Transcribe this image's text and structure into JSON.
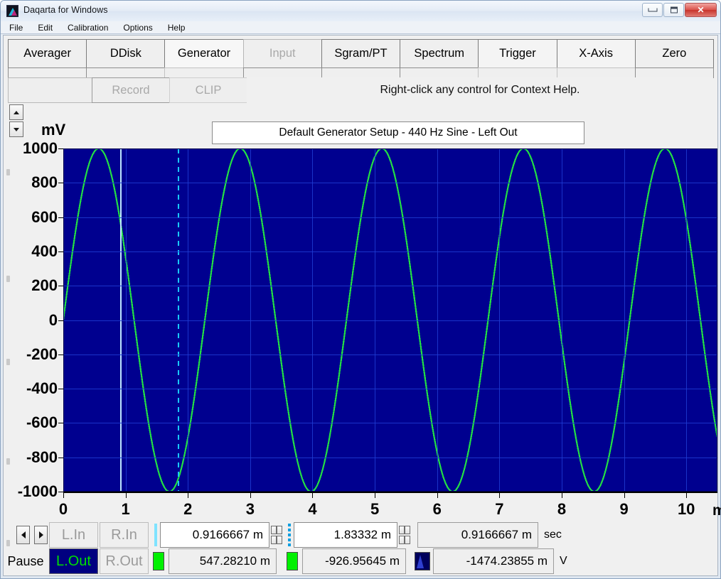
{
  "window": {
    "title": "Daqarta for Windows",
    "icon": "app-logo-icon",
    "minimize_label": "",
    "maximize_label": "",
    "close_label": "✕"
  },
  "menu": {
    "items": [
      "File",
      "Edit",
      "Calibration",
      "Options",
      "Help"
    ]
  },
  "toolbar": {
    "tabs": [
      {
        "label": "Averager",
        "state": "normal"
      },
      {
        "label": "DDisk",
        "state": "normal"
      },
      {
        "label": "Generator",
        "state": "selected"
      },
      {
        "label": "Input",
        "state": "disabled"
      },
      {
        "label": "Sgram/PT",
        "state": "normal"
      },
      {
        "label": "Spectrum",
        "state": "normal"
      },
      {
        "label": "Trigger",
        "state": "hatched"
      },
      {
        "label": "X-Axis",
        "state": "hatched"
      },
      {
        "label": "Zero",
        "state": "normal"
      }
    ],
    "record_label": "Record",
    "clip_label": "CLIP",
    "hint": "Right-click any control for Context Help."
  },
  "chart_data": {
    "type": "line",
    "title": "Default Generator Setup - 440 Hz Sine - Left Out",
    "ylabel": "mV",
    "xlabel": "m",
    "xunit": "m",
    "ylim": [
      -1000,
      1000
    ],
    "xlim": [
      0,
      10.5
    ],
    "yticks": [
      1000,
      800,
      600,
      400,
      200,
      0,
      -200,
      -400,
      -600,
      -800,
      -1000
    ],
    "xticks": [
      0,
      1,
      2,
      3,
      4,
      5,
      6,
      7,
      8,
      9,
      10
    ],
    "grid": true,
    "background": "#00008f",
    "grid_color": "#1e3cd2",
    "series": [
      {
        "name": "440 Hz Sine - Left Out",
        "color": "#22dd44",
        "frequency_hz": 440,
        "amplitude_mv": 1000,
        "phase_deg": 0,
        "waveform": "sine"
      }
    ],
    "cursors": [
      {
        "name": "main-cursor",
        "x_ms": 0.9166667,
        "style": "solid",
        "color": "#bfe9ff"
      },
      {
        "name": "delta-cursor",
        "x_ms": 1.83332,
        "style": "dashed",
        "color": "#19c8ff"
      }
    ]
  },
  "spinner": {
    "up": "▲",
    "down": "▼"
  },
  "controls": {
    "nav_prev": "◀",
    "nav_next": "▶",
    "pause_label": "Pause",
    "channels_in": [
      {
        "label": "L.In",
        "active": false
      },
      {
        "label": "R.In",
        "active": false
      }
    ],
    "channels_out": [
      {
        "label": "L.Out",
        "active": true
      },
      {
        "label": "R.Out",
        "active": false
      }
    ],
    "cursor_x_value": "0.9166667 m",
    "cursor_x_delta": "1.83332 m",
    "cursor_x_diff": "0.9166667 m",
    "x_unit": "sec",
    "cursor_y_value": "547.28210 m",
    "cursor_y_delta": "-926.95645 m",
    "cursor_y_diff": "-1474.23855 m",
    "y_unit": "V"
  }
}
